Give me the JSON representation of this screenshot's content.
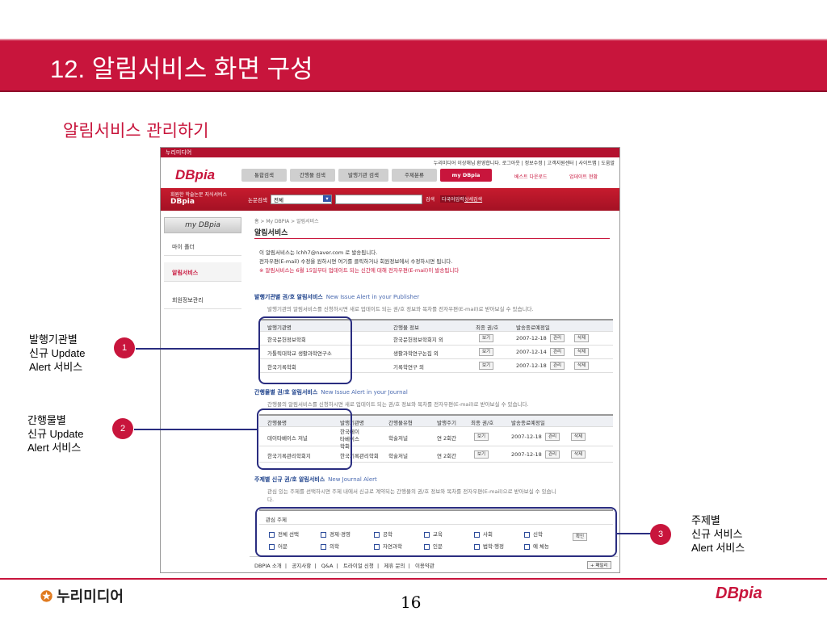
{
  "slide": {
    "title": "12. 알림서비스 화면 구성",
    "subtitle": "알림서비스 관리하기",
    "page_number": "16",
    "brand_left": "누리미디어",
    "brand_right": "DBpia"
  },
  "window": {
    "title": "누리미디어",
    "top_links": "누리미디어 이상해님 환영합니다.  로그아웃  |  정보수정  |  고객지원센터  |  사이트맵  |  도움말"
  },
  "header": {
    "logo": "DBpia",
    "nav_tabs": [
      "통합검색",
      "간행물 검색",
      "발행기관 검색",
      "주제분류",
      "my DBpia"
    ],
    "sub_links": [
      "베스트 다운로드",
      "업데이트 현황"
    ],
    "search_label": "논문검색",
    "search_select": "전체",
    "search_button": "검색",
    "detail_button": "다국어입력",
    "detail_link": "상세검색",
    "strip_text_1": "회원한 학술논문 지식서비스",
    "strip_text_2": "DBpia"
  },
  "sidebar": {
    "title": "my DBpia",
    "items": [
      "마이 폴더",
      "알림서비스",
      "회원정보관리"
    ]
  },
  "main": {
    "breadcrumb": "홈 > My DBPIA > 알림서비스",
    "heading": "알림서비스",
    "info_lines": [
      "이 알림서비스는 lchh7@naver.com 로 발송됩니다.",
      "전자우편(E-mail) 수정을 원하시면 여기를 클릭하거나 회원정보에서 수정하시면 됩니다.",
      "※ 알림서비스는 6월 15일부터 업데이트 되는 신간에 대해 전자우편(E-mail)이 발송됩니다"
    ],
    "publisher_section": {
      "title": "발행기관별 권/호 알림서비스",
      "title_en": "New Issue Alert in your Publisher",
      "desc": "발행기관의 알림서비스를 신청하시면 새로 업데이트 되는 권/호 정보와 목차를 전자우편(E-mail)로 받아보실 수 있습니다.",
      "headers": [
        "발행기관명",
        "간행물 정보",
        "최종 권/호",
        "발송종료예정일"
      ],
      "rows": [
        {
          "name": "한국문헌정보학회",
          "info": "한국문헌정보학회지 외",
          "date": "2007-12-18"
        },
        {
          "name": "가톨릭대학교 생활과학연구소",
          "info": "생활과학연구논집 외",
          "date": "2007-12-14"
        },
        {
          "name": "한국기록학회",
          "info": "기록학연구 외",
          "date": "2007-12-18"
        }
      ]
    },
    "journal_section": {
      "title": "간행물별 권/호 알림서비스",
      "title_en": "New Issue Alert in your Journal",
      "desc": "간행물의 알림서비스를 신청하시면 새로 업데이트 되는 권/호 정보와 목차를 전자우편(E-mail)로 받아보실 수 있습니다.",
      "headers": [
        "간행물명",
        "발행기관명",
        "간행물유형",
        "발행주기",
        "최종 권/호",
        "발송종료예정일"
      ],
      "rows": [
        {
          "name": "데이타베이스 저널",
          "publisher": "한국데이타베이스 학회",
          "type": "학술저널",
          "cycle": "연 2회간",
          "date": "2007-12-18"
        },
        {
          "name": "한국기록관리학회지",
          "publisher": "한국기록관리학회",
          "type": "학술저널",
          "cycle": "연 2회간",
          "date": "2007-12-18"
        }
      ]
    },
    "subject_section": {
      "title": "주제별 신규 권/호 알림서비스",
      "title_en": "New Journal Alert",
      "desc_1": "관심 있는 주제를 선택하시면 주제 내에서 신규로 계약되는 간행물의 권/호 정보와 목차를 전자우편(E-mail)으로 받아보실 수 있습니",
      "desc_2": "다.",
      "box_title": "관심 주제",
      "subjects_row1": [
        "전체 선택",
        "경제·경영",
        "공학",
        "교육",
        "사회",
        "신학"
      ],
      "subjects_row2": [
        "어문",
        "의학",
        "자연과학",
        "인문",
        "법학·행정",
        "예 체능"
      ],
      "confirm_button": "확인"
    },
    "buttons": {
      "view": "보기",
      "manage": "관리",
      "delete": "삭제"
    }
  },
  "footer_nav": {
    "items": [
      "DBPIA 소개",
      "공지사항",
      "Q&A",
      "트라이얼 신청",
      "제휴 문의",
      "이용약관"
    ],
    "family_site": "+ 패밀리"
  },
  "callouts": [
    {
      "number": "1",
      "lines": [
        "발행기관별",
        "신규 Update",
        "Alert 서비스"
      ]
    },
    {
      "number": "2",
      "lines": [
        "간행물별",
        "신규 Update",
        "Alert 서비스"
      ]
    },
    {
      "number": "3",
      "lines": [
        "주제별",
        "신규 서비스",
        "Alert 서비스"
      ]
    }
  ],
  "colors": {
    "accent": "#c8153c",
    "callout": "#2a2d80"
  }
}
